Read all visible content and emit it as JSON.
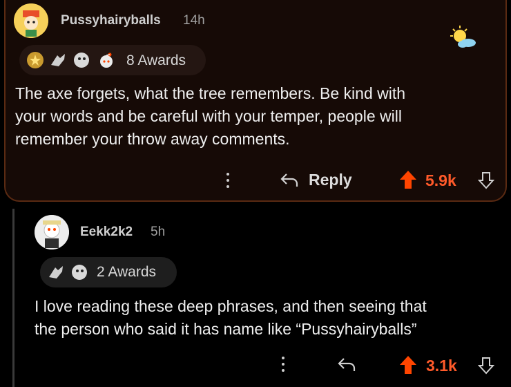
{
  "comment1": {
    "username": "Pussyhairyballs",
    "time": "14h",
    "awards": "8 Awards",
    "text_line1": "The axe forgets, what the tree remembers. Be kind with",
    "text_line2": "your words and be careful with your temper, people will",
    "text_line3": "remember your throw away comments.",
    "reply_label": "Reply",
    "votes": "5.9k"
  },
  "comment2": {
    "username": "Eekk2k2",
    "time": "5h",
    "awards": "2 Awards",
    "text_line1": "I love reading these deep phrases, and then seeing that",
    "text_line2": "the person who said it has name like “Pussyhairyballs”",
    "votes": "3.1k"
  },
  "colors": {
    "upvote": "#ff4500",
    "card_bg": "#160a06",
    "card_border": "#5a2a12"
  }
}
